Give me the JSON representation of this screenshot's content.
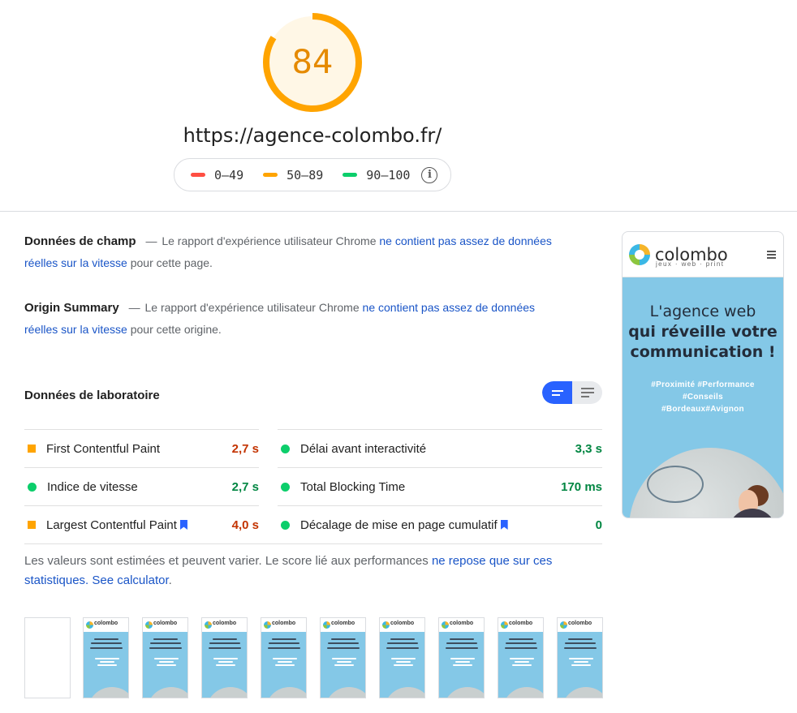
{
  "header": {
    "score": "84",
    "score_color": "#ffa400",
    "url": "https://agence-colombo.fr/",
    "legend": [
      {
        "label": "0–49",
        "color": "#ff4e42"
      },
      {
        "label": "50–89",
        "color": "#ffa400"
      },
      {
        "label": "90–100",
        "color": "#0cce6b"
      }
    ],
    "info_icon": "info-icon"
  },
  "field_data": {
    "title": "Données de champ",
    "sep": "—",
    "text1": "Le rapport d'expérience utilisateur Chrome",
    "link": "ne contient pas assez de données réelles sur la vitesse",
    "text2": "pour cette page."
  },
  "origin_summary": {
    "title": "Origin Summary",
    "sep": "—",
    "text1": "Le rapport d'expérience utilisateur Chrome",
    "link": "ne contient pas assez de données réelles sur la vitesse",
    "text2": "pour cette origine."
  },
  "lab_data": {
    "title": "Données de laboratoire",
    "metrics_left": [
      {
        "name": "First Contentful Paint",
        "value": "2,7 s",
        "status": "average"
      },
      {
        "name": "Indice de vitesse",
        "value": "2,7 s",
        "status": "pass"
      },
      {
        "name": "Largest Contentful Paint",
        "value": "4,0 s",
        "status": "average"
      }
    ],
    "metrics_right": [
      {
        "name": "Délai avant interactivité",
        "value": "3,3 s",
        "status": "pass"
      },
      {
        "name": "Total Blocking Time",
        "value": "170 ms",
        "status": "pass"
      },
      {
        "name": "Décalage de mise en page cumulatif",
        "value": "0",
        "status": "pass"
      }
    ],
    "note_text": "Les valeurs sont estimées et peuvent varier. Le score lié aux performances",
    "note_link": "ne repose que sur ces statistiques.",
    "calc_link": "See calculator",
    "note_end": "."
  },
  "preview": {
    "brand": "colombo",
    "tagline": "jeux · web · print",
    "headline_light": "L'agence web",
    "headline_bold_1": "qui réveille votre",
    "headline_bold_2": "communication !",
    "tags_1": "#Proximité #Performance",
    "tags_2": "#Conseils",
    "tags_3": "#Bordeaux#Avignon",
    "hero_color": "#84c8e7"
  },
  "filmstrip": {
    "brand": "colombo",
    "frame_count": 9
  }
}
